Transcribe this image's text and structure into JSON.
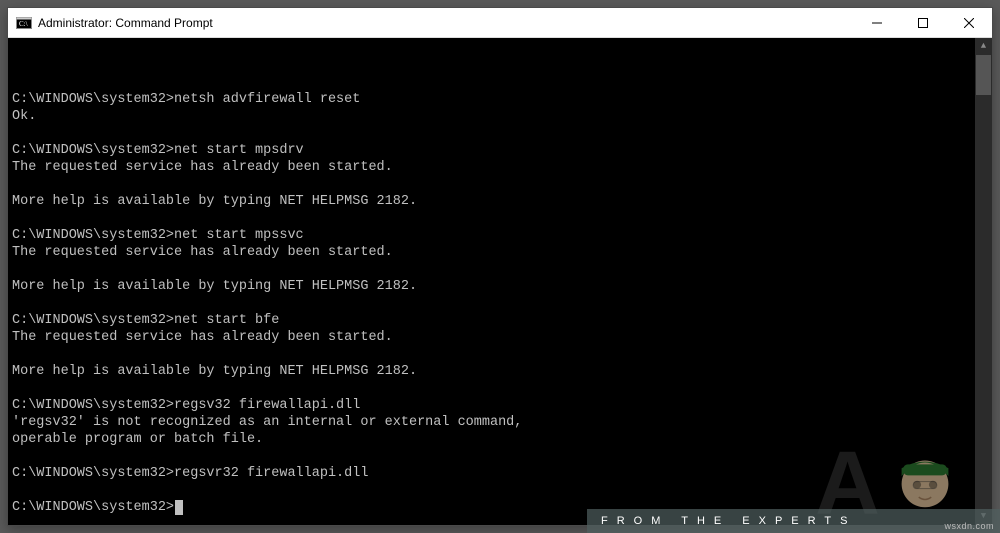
{
  "window": {
    "title": "Administrator: Command Prompt"
  },
  "terminal": {
    "prompt": "C:\\WINDOWS\\system32>",
    "blocks": [
      {
        "cmd": "netsh advfirewall reset",
        "out": "Ok."
      },
      {
        "cmd": "net start mpsdrv",
        "out": "The requested service has already been started.\n\nMore help is available by typing NET HELPMSG 2182."
      },
      {
        "cmd": "net start mpssvc",
        "out": "The requested service has already been started.\n\nMore help is available by typing NET HELPMSG 2182."
      },
      {
        "cmd": "net start bfe",
        "out": "The requested service has already been started.\n\nMore help is available by typing NET HELPMSG 2182."
      },
      {
        "cmd": "regsv32 firewallapi.dll",
        "out": "'regsv32' is not recognized as an internal or external command,\noperable program or batch file."
      },
      {
        "cmd": "regsvr32 firewallapi.dll",
        "out": ""
      }
    ],
    "current_prompt": "C:\\WINDOWS\\system32>"
  },
  "watermark": {
    "tagline": "FROM THE EXPERTS",
    "attrib": "wsxdn.com"
  }
}
